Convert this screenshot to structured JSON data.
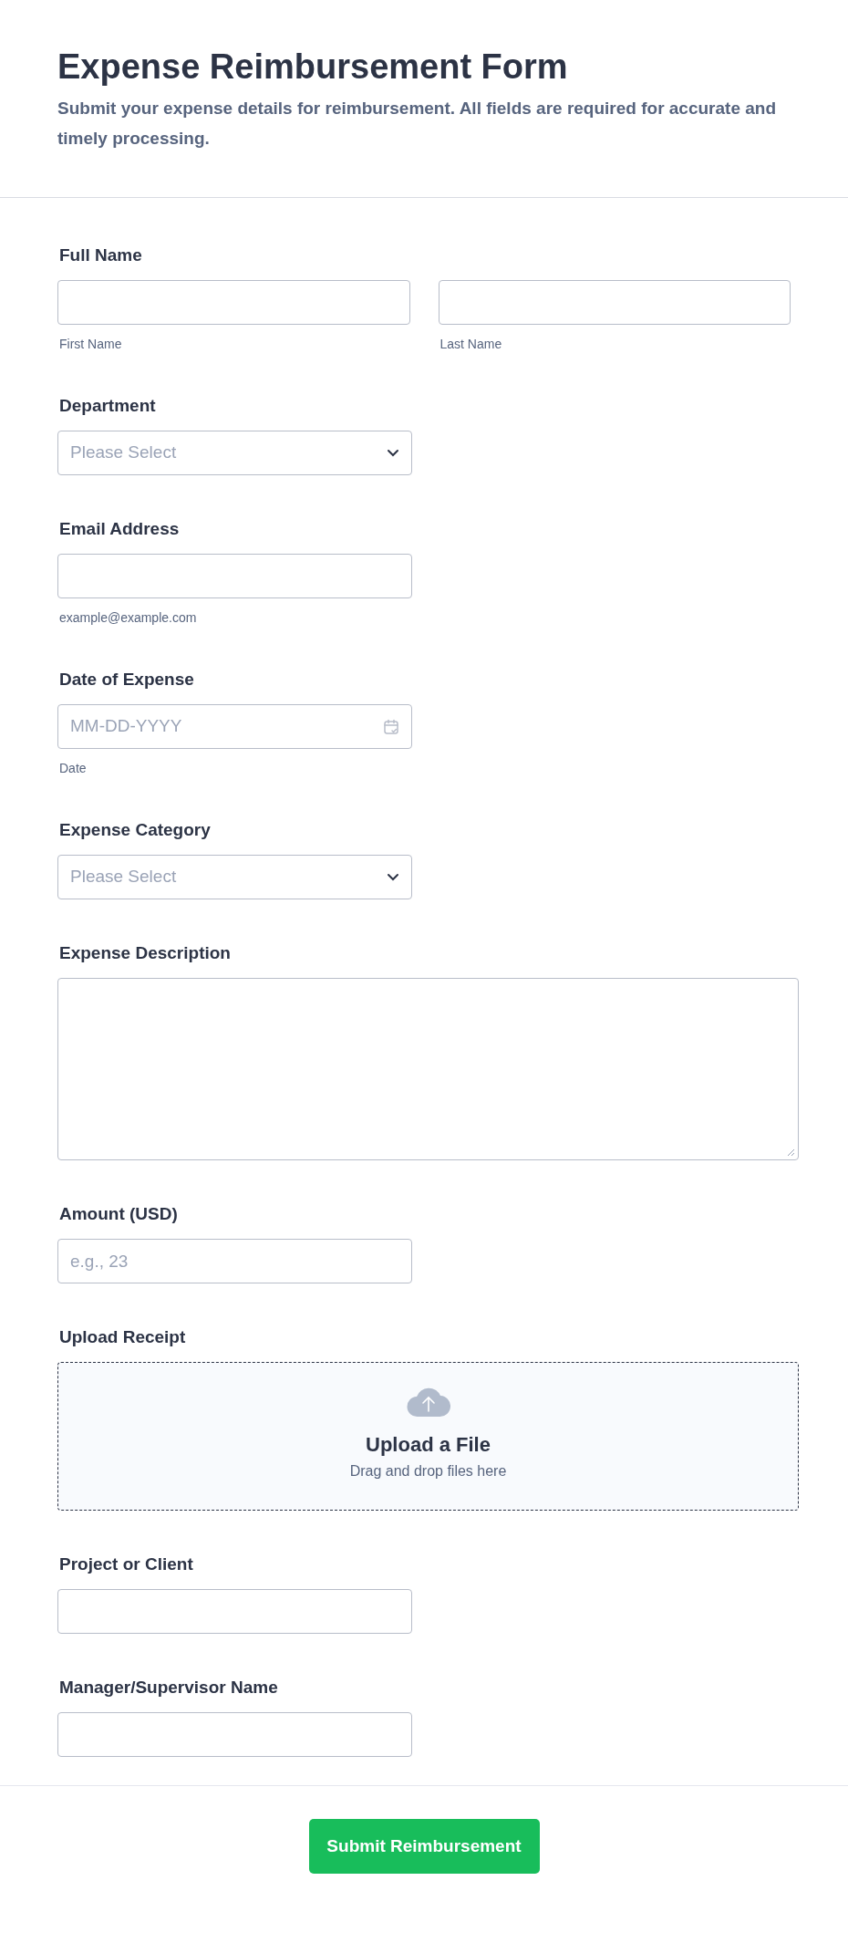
{
  "header": {
    "title": "Expense Reimbursement Form",
    "description": "Submit your expense details for reimbursement. All fields are required for accurate and timely processing."
  },
  "fields": [
    {
      "kind": "name",
      "label": "Full Name",
      "parts": [
        {
          "sublabel": "First Name"
        },
        {
          "sublabel": "Last Name"
        }
      ]
    },
    {
      "kind": "select",
      "label": "Department",
      "placeholder": "Please Select"
    },
    {
      "kind": "text",
      "label": "Email Address",
      "sublabel": "example@example.com"
    },
    {
      "kind": "date",
      "label": "Date of Expense",
      "placeholder": "MM-DD-YYYY",
      "sublabel": "Date"
    },
    {
      "kind": "select",
      "label": "Expense Category",
      "placeholder": "Please Select"
    },
    {
      "kind": "textarea",
      "label": "Expense Description"
    },
    {
      "kind": "text",
      "label": "Amount (USD)",
      "placeholder": "e.g., 23"
    },
    {
      "kind": "upload",
      "label": "Upload Receipt",
      "title": "Upload a File",
      "hint": "Drag and drop files here"
    },
    {
      "kind": "text",
      "label": "Project or Client"
    },
    {
      "kind": "text",
      "label": "Manager/Supervisor Name"
    }
  ],
  "submit": {
    "label": "Submit Reimbursement"
  }
}
